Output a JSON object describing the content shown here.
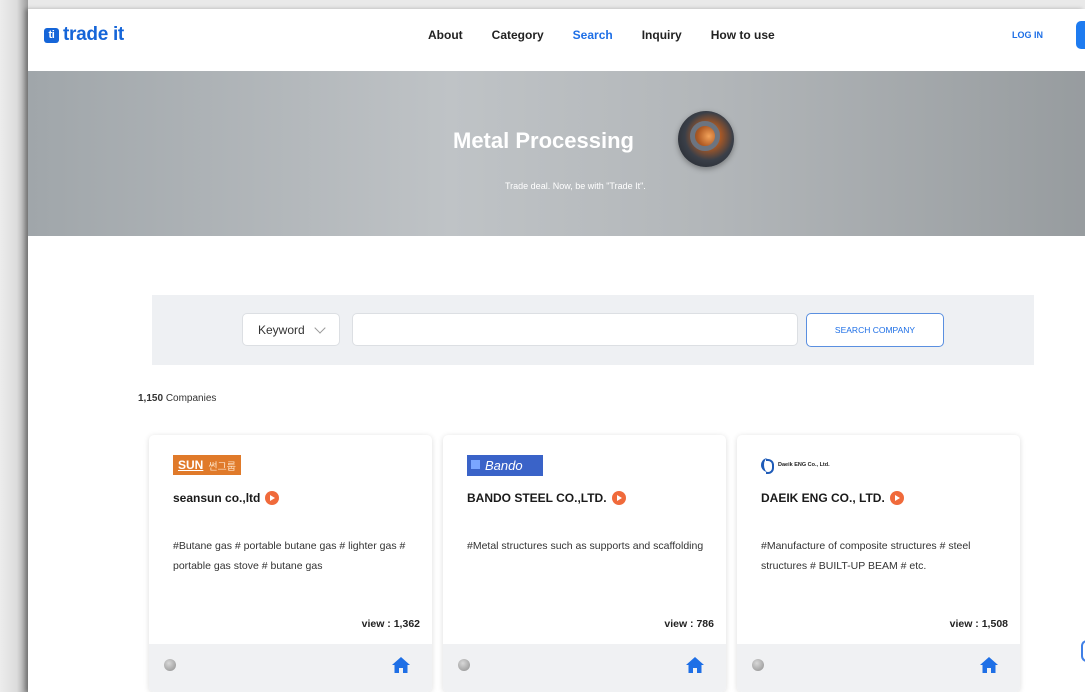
{
  "header": {
    "logo_text": "trade it",
    "logo_mark": "ti",
    "nav": [
      {
        "label": "About",
        "active": false
      },
      {
        "label": "Category",
        "active": false
      },
      {
        "label": "Search",
        "active": true
      },
      {
        "label": "Inquiry",
        "active": false
      },
      {
        "label": "How to use",
        "active": false
      }
    ],
    "login_label": "LOG IN"
  },
  "hero": {
    "title": "Metal Processing",
    "subtitle": "Trade deal. Now, be with \"Trade It\"."
  },
  "search": {
    "select_value": "Keyword",
    "input_value": "",
    "button_label": "SEARCH COMPANY"
  },
  "results": {
    "count": "1,150",
    "count_suffix": "Companies"
  },
  "cards": [
    {
      "logo": {
        "text_a": "SUN",
        "text_b": "썬그룹"
      },
      "name": "seansun co.,ltd",
      "tags": "#Butane gas # portable butane gas # lighter gas # portable gas stove # butane gas",
      "views": "view : 1,362"
    },
    {
      "logo": {
        "text": "Bando"
      },
      "name": "BANDO STEEL CO.,LTD.",
      "tags": "#Metal structures such as supports and scaffolding",
      "views": "view : 786"
    },
    {
      "logo": {
        "text": "Daeik ENG Co., Ltd."
      },
      "name": "DAEIK ENG CO., LTD.",
      "tags": "#Manufacture of composite structures # steel structures # BUILT-UP BEAM # etc.",
      "views": "view : 1,508"
    }
  ],
  "colors": {
    "brand": "#1565d8",
    "accent": "#1e6fe6",
    "video_badge": "#f06a3b"
  }
}
